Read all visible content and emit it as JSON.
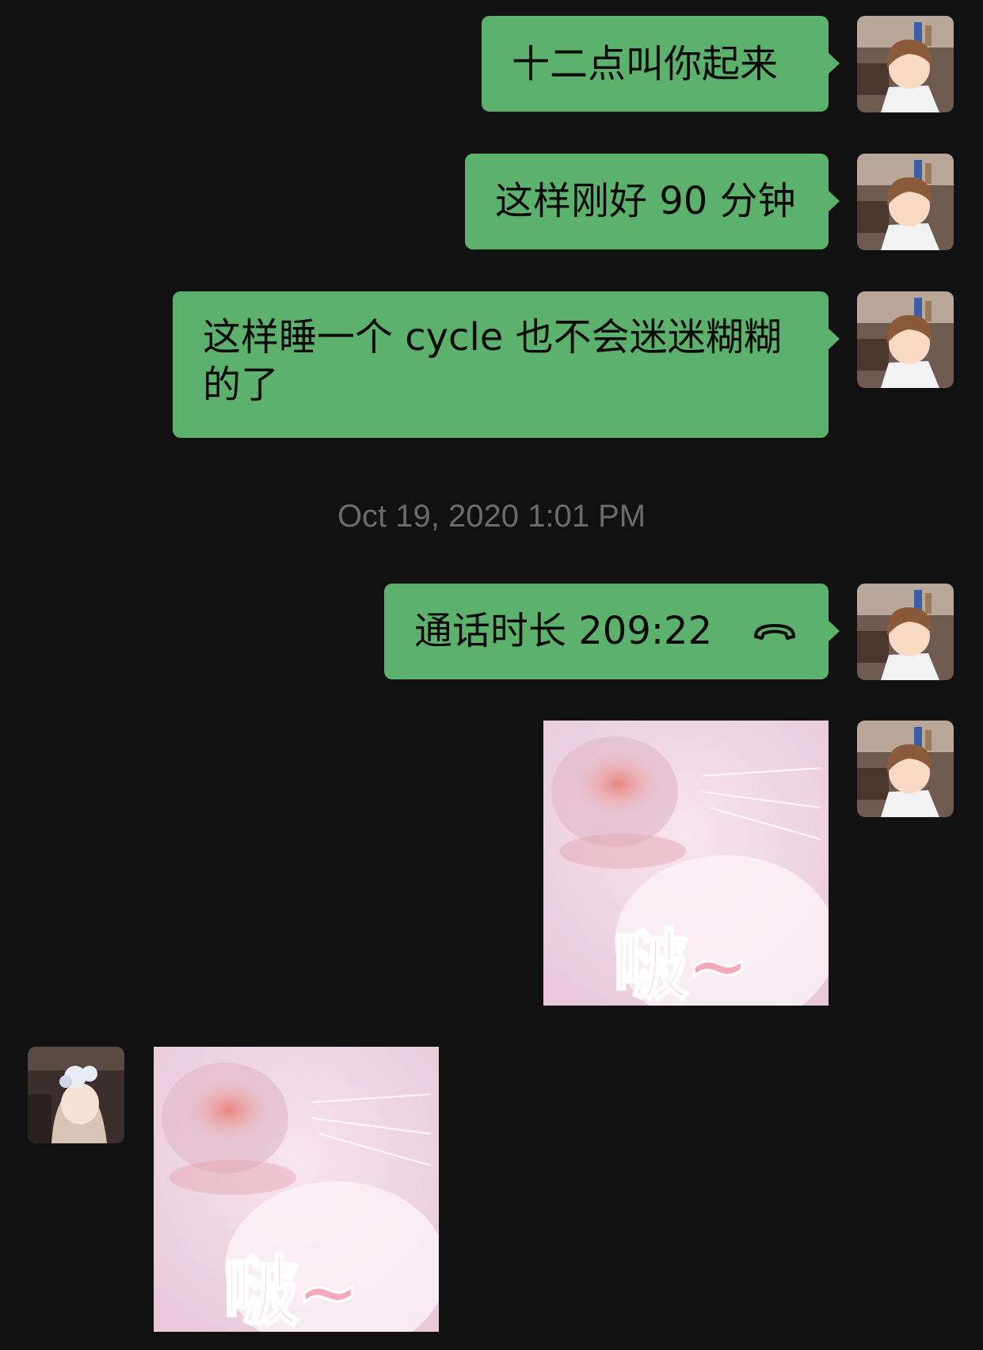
{
  "messages": [
    {
      "side": "me",
      "type": "text",
      "text": "十二点叫你起来"
    },
    {
      "side": "me",
      "type": "text",
      "text": "这样刚好 90 分钟"
    },
    {
      "side": "me",
      "type": "text",
      "text": "这样睡一个 cycle 也不会迷迷糊糊\n的了"
    },
    {
      "side": "me",
      "type": "call",
      "text": "通话时长 209:22",
      "icon": "phone-hangup-icon"
    },
    {
      "side": "me",
      "type": "sticker",
      "caption": "啵~"
    },
    {
      "side": "other",
      "type": "sticker",
      "caption": "啵~"
    }
  ],
  "timestamp": "Oct 19, 2020 1:01 PM",
  "colors": {
    "background": "#111111",
    "bubble_me": "#5cb26d",
    "timestamp_text": "#6b6b6b",
    "sticker_caption": "#f4a8b8"
  },
  "avatars": {
    "me": "anime-boy-avatar",
    "other": "anime-girl-avatar"
  }
}
